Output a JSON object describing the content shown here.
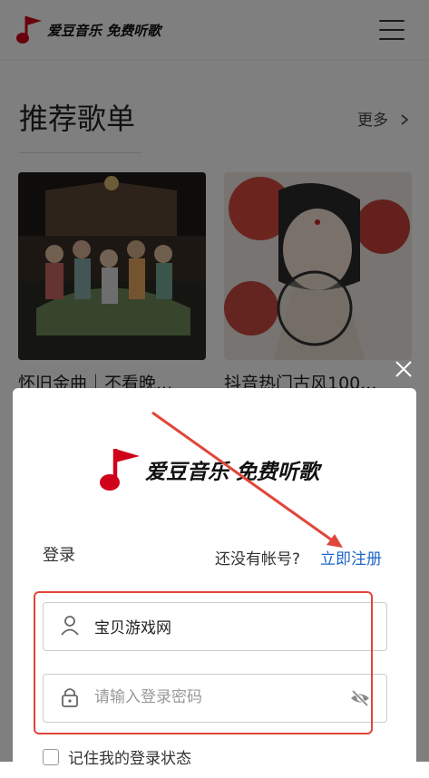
{
  "header": {
    "logo_text": "爱豆音乐 免费听歌",
    "logo_icon": "music-note-flag-icon",
    "menu_icon": "hamburger-menu-icon"
  },
  "section": {
    "title": "推荐歌单",
    "more_label": "更多",
    "more_icon": "chevron-right-icon"
  },
  "playlists": [
    {
      "title": "怀旧金曲｜不看晚..."
    },
    {
      "title": "抖音热门古风100..."
    }
  ],
  "login_dialog": {
    "close_icon": "close-icon",
    "logo_text": "爱豆音乐 免费听歌",
    "login_label": "登录",
    "no_account_text": "还没有帐号?",
    "register_label": "立即注册",
    "username_value": "宝贝游戏网",
    "password_placeholder": "请输入登录密码",
    "remember_label": "记住我的登录状态",
    "user_icon": "user-icon",
    "lock_icon": "lock-icon",
    "eye_icon": "eye-slash-icon"
  },
  "colors": {
    "brand_red": "#d0021b",
    "link_blue": "#1e66c8",
    "annotation_red": "#e0463a"
  }
}
